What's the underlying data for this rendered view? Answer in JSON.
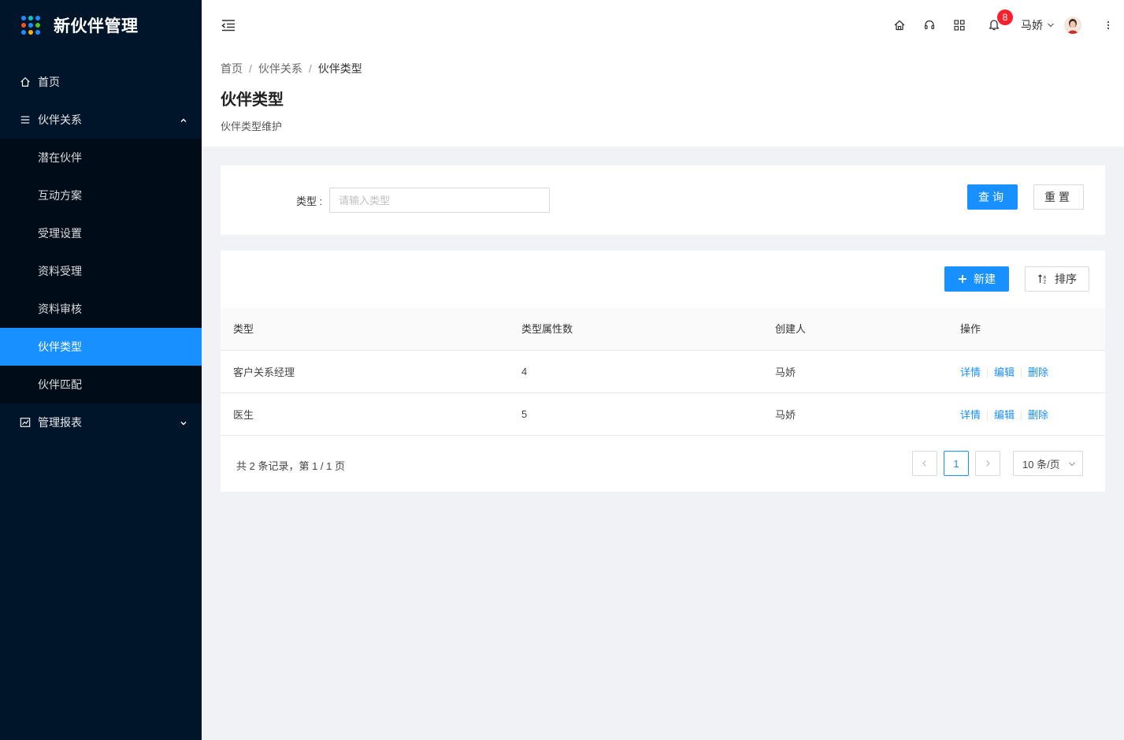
{
  "app": {
    "title": "新伙伴管理"
  },
  "sidebar": {
    "items": [
      {
        "label": "首页",
        "icon": "home-icon"
      },
      {
        "label": "伙伴关系",
        "icon": "menu-list-icon",
        "expanded": true,
        "children": [
          "潜在伙伴",
          "互动方案",
          "受理设置",
          "资料受理",
          "资料审核",
          "伙伴类型",
          "伙伴匹配"
        ],
        "active_child": "伙伴类型"
      },
      {
        "label": "管理报表",
        "icon": "chart-icon",
        "expanded": false
      }
    ]
  },
  "header": {
    "notification_count": "8",
    "user_name": "马娇"
  },
  "breadcrumb": [
    "首页",
    "伙伴关系",
    "伙伴类型"
  ],
  "breadcrumb_separator": "/",
  "page": {
    "title": "伙伴类型",
    "description": "伙伴类型维护"
  },
  "filter": {
    "type_label": "类型 :",
    "type_placeholder": "请输入类型",
    "type_value": "",
    "query_label": "查询",
    "reset_label": "重置"
  },
  "toolbar": {
    "new_label": "新建",
    "sort_label": "排序"
  },
  "table": {
    "columns": [
      "类型",
      "类型属性数",
      "创建人",
      "操作"
    ],
    "rows": [
      {
        "type": "客户关系经理",
        "attr_count": "4",
        "creator": "马娇"
      },
      {
        "type": "医生",
        "attr_count": "5",
        "creator": "马娇"
      }
    ],
    "actions": [
      "详情",
      "编辑",
      "删除"
    ]
  },
  "pagination": {
    "summary": "共 2 条记录，第 1 / 1 页",
    "current_page": "1",
    "page_size": "10 条/页"
  },
  "colors": {
    "sidebar_bg": "#001529",
    "submenu_bg": "#000c17",
    "accent": "#1890ff",
    "badge": "#f5222d",
    "logo_dots": [
      "#1890ff",
      "#13c2c2",
      "#1890ff",
      "#fa541c",
      "#1890ff",
      "#52c41a",
      "#1890ff",
      "#faad14",
      "#1890ff"
    ]
  }
}
